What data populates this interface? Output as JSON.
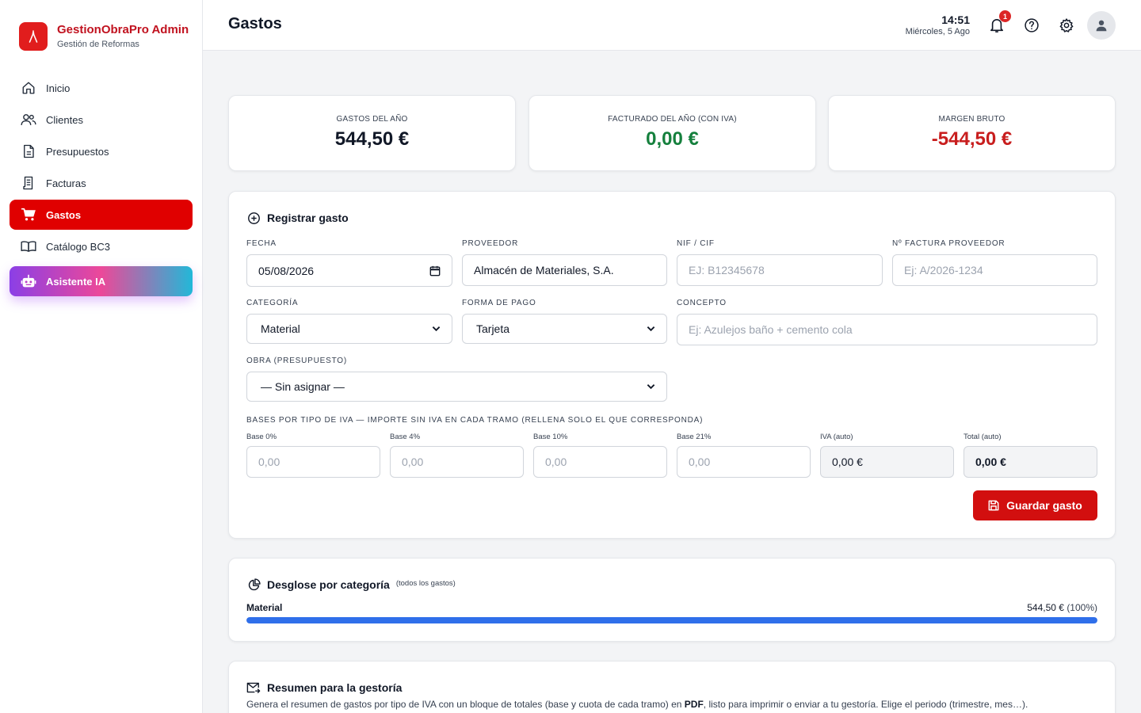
{
  "brand": {
    "name": "GestionObraPro Admin",
    "subtitle": "Gestión de Reformas"
  },
  "nav": [
    {
      "label": "Inicio",
      "icon": "home-icon"
    },
    {
      "label": "Clientes",
      "icon": "users-icon"
    },
    {
      "label": "Presupuestos",
      "icon": "document-icon"
    },
    {
      "label": "Facturas",
      "icon": "receipt-icon"
    },
    {
      "label": "Gastos",
      "icon": "cart-icon",
      "active": true
    },
    {
      "label": "Catálogo BC3",
      "icon": "book-icon"
    },
    {
      "label": "Asistente IA",
      "icon": "robot-icon"
    }
  ],
  "header": {
    "title": "Gastos",
    "time": "14:51",
    "date": "Miércoles, 5 Ago",
    "notifications": "1"
  },
  "stats": [
    {
      "label": "GASTOS DEL AÑO",
      "value": "544,50 €",
      "color": "#111827"
    },
    {
      "label": "FACTURADO DEL AÑO (CON IVA)",
      "value": "0,00 €",
      "color": "#15803d"
    },
    {
      "label": "MARGEN BRUTO",
      "value": "-544,50 €",
      "color": "#c81e1e"
    }
  ],
  "form": {
    "title": "Registrar gasto",
    "fecha_label": "FECHA",
    "fecha_value": "05/08/2026",
    "proveedor_label": "PROVEEDOR",
    "proveedor_value": "Almacén de Materiales, S.A.",
    "nif_label": "NIF / CIF",
    "nif_placeholder": "EJ: B12345678",
    "factura_label": "Nº FACTURA PROVEEDOR",
    "factura_placeholder": "Ej: A/2026-1234",
    "categoria_label": "CATEGORÍA",
    "categoria_value": "Material",
    "pago_label": "FORMA DE PAGO",
    "pago_value": "Tarjeta",
    "concepto_label": "CONCEPTO",
    "concepto_placeholder": "Ej: Azulejos baño + cemento cola",
    "obra_label": "OBRA (PRESUPUESTO)",
    "obra_value": "— Sin asignar —",
    "bases_label": "BASES POR TIPO DE IVA — IMPORTE SIN IVA EN CADA TRAMO (RELLENA SOLO EL QUE CORRESPONDA)",
    "bases": [
      {
        "label": "Base 0%",
        "placeholder": "0,00"
      },
      {
        "label": "Base 4%",
        "placeholder": "0,00"
      },
      {
        "label": "Base 10%",
        "placeholder": "0,00"
      },
      {
        "label": "Base 21%",
        "placeholder": "0,00"
      }
    ],
    "iva_label": "IVA (auto)",
    "iva_value": "0,00 €",
    "total_label": "Total (auto)",
    "total_value": "0,00 €",
    "save_label": "Guardar gasto"
  },
  "breakdown": {
    "title": "Desglose por categoría",
    "note": "(todos los gastos)",
    "category": "Material",
    "amount": "544,50 €",
    "percent_text": "(100%)",
    "fraction": 1.0,
    "bar_color": "#2f6fea"
  },
  "summary": {
    "title": "Resumen para la gestoría",
    "text_before": "Genera el resumen de gastos por tipo de IVA con un bloque de totales (base y cuota de cada tramo) en ",
    "text_bold": "PDF",
    "text_after": ", listo para imprimir o enviar a tu gestoría. Elige el periodo (trimestre, mes…)."
  }
}
